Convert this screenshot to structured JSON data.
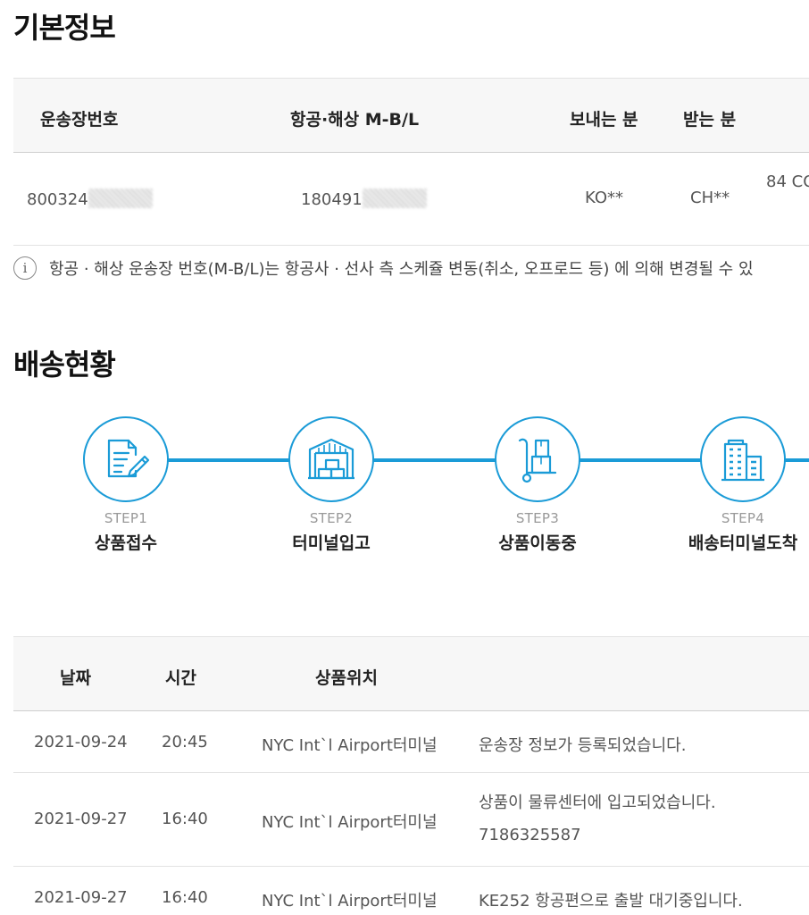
{
  "basic_info": {
    "title": "기본정보",
    "headers": {
      "waybill": "운송장번호",
      "mbl": "항공·해상 M-B/L",
      "sender": "보내는 분",
      "receiver": "받는 분"
    },
    "row": {
      "waybill": "800324",
      "mbl": "180491",
      "sender": "KO**",
      "receiver": "CH**",
      "address": "84 CO"
    },
    "notice": "항공 · 해상 운송장 번호(M-B/L)는 항공사 · 선사 측 스케쥴 변동(취소, 오프로드 등) 에 의해 변경될 수 있"
  },
  "delivery_status": {
    "title": "배송현황",
    "steps": [
      {
        "no": "STEP1",
        "name": "상품접수",
        "icon": "document-pen-icon"
      },
      {
        "no": "STEP2",
        "name": "터미널입고",
        "icon": "warehouse-boxes-icon"
      },
      {
        "no": "STEP3",
        "name": "상품이동중",
        "icon": "hand-truck-icon"
      },
      {
        "no": "STEP4",
        "name": "배송터미널도착",
        "icon": "buildings-icon"
      }
    ],
    "accent_color": "#1a9bd7"
  },
  "history": {
    "headers": {
      "date": "날짜",
      "time": "시간",
      "location": "상품위치"
    },
    "rows": [
      {
        "date": "2021-09-24",
        "time": "20:45",
        "location": "NYC Int`l Airport터미널",
        "desc": "운송장 정보가 등록되었습니다.",
        "desc2": ""
      },
      {
        "date": "2021-09-27",
        "time": "16:40",
        "location": "NYC Int`l Airport터미널",
        "desc": "상품이 물류센터에 입고되었습니다.",
        "desc2": "7186325587"
      },
      {
        "date": "2021-09-27",
        "time": "16:40",
        "location": "NYC Int`l Airport터미널",
        "desc": "KE252 항공편으로 출발 대기중입니다.",
        "desc2": ""
      }
    ]
  }
}
